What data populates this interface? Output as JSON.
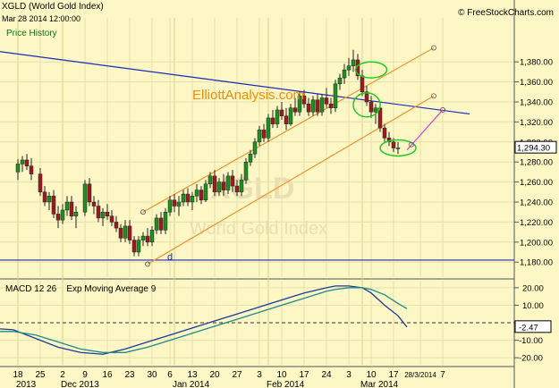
{
  "header": {
    "symbol_line": "XGLD (World Gold Index)",
    "datetime": "Mar 28 2014 12:00:00",
    "source": "© FreeStockCharts.com",
    "price_history_label": "Price History",
    "elliott_watermark": "ElliottAnalysis.com",
    "big_watermark_symbol": "XGLD",
    "big_watermark_name": "World Gold Index"
  },
  "colors": {
    "background": "#fdf7c6",
    "up_candle": "#1f8f1f",
    "down_candle": "#9b1c1c",
    "channel": "#f0932c",
    "trendline": "#1a2ab8",
    "projection": "#e03ccf",
    "ellipse": "#22c922",
    "macd_line": "#1a3a9c",
    "signal_line": "#1e8a8a"
  },
  "chart_data": [
    {
      "type": "candlestick",
      "title": "Price History",
      "series_name": "XGLD (World Gold Index)",
      "ylim": [
        1165,
        1415
      ],
      "y_ticks": [
        "1,180.00",
        "1,200.00",
        "1,220.00",
        "1,240.00",
        "1,260.00",
        "1,280.00",
        "1,300.00",
        "1,320.00",
        "1,340.00",
        "1,360.00",
        "1,380.00"
      ],
      "y_tick_values": [
        1180,
        1200,
        1220,
        1240,
        1260,
        1280,
        1300,
        1320,
        1340,
        1360,
        1380
      ],
      "last_value_label": "1,294.30",
      "last_value": 1294.3,
      "x_ticks": [
        "18",
        "25",
        "2",
        "9",
        "16",
        "23",
        "30",
        "6",
        "13",
        "20",
        "27",
        "3",
        "10",
        "17",
        "24",
        "3",
        "10",
        "17",
        "28/3/2014",
        "7"
      ],
      "x_tick_indices": [
        1,
        6,
        11,
        16,
        21,
        26,
        31,
        35,
        40,
        45,
        50,
        55,
        60,
        65,
        70,
        75,
        80,
        85,
        91,
        96
      ],
      "month_labels": [
        {
          "label": "2013",
          "index": -1
        },
        {
          "label": "Dec 2013",
          "index": 9
        },
        {
          "label": "Jan 2014",
          "index": 34
        },
        {
          "label": "Feb 2014",
          "index": 55
        },
        {
          "label": "Mar 2014",
          "index": 76
        }
      ],
      "x_slots": 101,
      "candles": [
        [
          1,
          1270,
          1283,
          1262,
          1278
        ],
        [
          2,
          1278,
          1286,
          1270,
          1282
        ],
        [
          3,
          1282,
          1288,
          1272,
          1276
        ],
        [
          4,
          1276,
          1284,
          1262,
          1268
        ],
        [
          6,
          1268,
          1274,
          1246,
          1250
        ],
        [
          7,
          1250,
          1256,
          1236,
          1240
        ],
        [
          8,
          1240,
          1250,
          1232,
          1246
        ],
        [
          9,
          1246,
          1252,
          1224,
          1228
        ],
        [
          10,
          1228,
          1236,
          1214,
          1222
        ],
        [
          11,
          1222,
          1238,
          1218,
          1232
        ],
        [
          12,
          1232,
          1246,
          1226,
          1240
        ],
        [
          13,
          1240,
          1246,
          1222,
          1226
        ],
        [
          14,
          1226,
          1236,
          1214,
          1230
        ],
        [
          16,
          1230,
          1262,
          1226,
          1258
        ],
        [
          17,
          1258,
          1264,
          1236,
          1240
        ],
        [
          18,
          1240,
          1246,
          1228,
          1236
        ],
        [
          19,
          1236,
          1242,
          1220,
          1224
        ],
        [
          20,
          1224,
          1234,
          1216,
          1230
        ],
        [
          21,
          1230,
          1238,
          1222,
          1226
        ],
        [
          22,
          1226,
          1232,
          1216,
          1220
        ],
        [
          23,
          1220,
          1226,
          1210,
          1214
        ],
        [
          24,
          1214,
          1218,
          1200,
          1204
        ],
        [
          25,
          1204,
          1222,
          1200,
          1216
        ],
        [
          26,
          1216,
          1222,
          1198,
          1202
        ],
        [
          27,
          1202,
          1206,
          1186,
          1190
        ],
        [
          28,
          1190,
          1206,
          1186,
          1202
        ],
        [
          29,
          1202,
          1210,
          1196,
          1206
        ],
        [
          30,
          1206,
          1214,
          1196,
          1200
        ],
        [
          31,
          1200,
          1216,
          1196,
          1212
        ],
        [
          32,
          1212,
          1228,
          1208,
          1224
        ],
        [
          33,
          1224,
          1230,
          1208,
          1212
        ],
        [
          34,
          1212,
          1234,
          1208,
          1230
        ],
        [
          35,
          1230,
          1246,
          1226,
          1242
        ],
        [
          36,
          1242,
          1248,
          1230,
          1236
        ],
        [
          37,
          1236,
          1246,
          1226,
          1240
        ],
        [
          38,
          1240,
          1252,
          1236,
          1248
        ],
        [
          39,
          1248,
          1254,
          1236,
          1240
        ],
        [
          40,
          1240,
          1250,
          1232,
          1246
        ],
        [
          41,
          1246,
          1258,
          1240,
          1252
        ],
        [
          42,
          1252,
          1256,
          1238,
          1242
        ],
        [
          43,
          1242,
          1262,
          1240,
          1258
        ],
        [
          44,
          1258,
          1270,
          1254,
          1266
        ],
        [
          45,
          1266,
          1272,
          1246,
          1250
        ],
        [
          46,
          1250,
          1264,
          1246,
          1260
        ],
        [
          47,
          1260,
          1268,
          1246,
          1252
        ],
        [
          48,
          1252,
          1270,
          1248,
          1266
        ],
        [
          49,
          1266,
          1272,
          1250,
          1256
        ],
        [
          50,
          1256,
          1262,
          1246,
          1250
        ],
        [
          51,
          1250,
          1268,
          1246,
          1262
        ],
        [
          52,
          1262,
          1284,
          1258,
          1280
        ],
        [
          53,
          1280,
          1292,
          1276,
          1288
        ],
        [
          54,
          1288,
          1304,
          1284,
          1300
        ],
        [
          55,
          1300,
          1316,
          1296,
          1312
        ],
        [
          56,
          1312,
          1318,
          1300,
          1304
        ],
        [
          57,
          1304,
          1328,
          1300,
          1324
        ],
        [
          58,
          1324,
          1332,
          1314,
          1318
        ],
        [
          59,
          1318,
          1336,
          1314,
          1332
        ],
        [
          60,
          1332,
          1340,
          1322,
          1326
        ],
        [
          61,
          1326,
          1334,
          1312,
          1318
        ],
        [
          62,
          1318,
          1338,
          1316,
          1334
        ],
        [
          63,
          1334,
          1344,
          1326,
          1330
        ],
        [
          64,
          1330,
          1350,
          1326,
          1346
        ],
        [
          65,
          1346,
          1352,
          1334,
          1338
        ],
        [
          66,
          1338,
          1344,
          1326,
          1330
        ],
        [
          67,
          1330,
          1346,
          1326,
          1342
        ],
        [
          68,
          1342,
          1348,
          1326,
          1330
        ],
        [
          69,
          1330,
          1348,
          1326,
          1344
        ],
        [
          70,
          1344,
          1354,
          1334,
          1338
        ],
        [
          71,
          1338,
          1344,
          1328,
          1334
        ],
        [
          72,
          1334,
          1362,
          1330,
          1358
        ],
        [
          73,
          1358,
          1368,
          1352,
          1364
        ],
        [
          74,
          1364,
          1378,
          1358,
          1372
        ],
        [
          75,
          1372,
          1384,
          1366,
          1376
        ],
        [
          76,
          1376,
          1392,
          1370,
          1382
        ],
        [
          77,
          1382,
          1388,
          1362,
          1366
        ],
        [
          78,
          1366,
          1372,
          1346,
          1350
        ],
        [
          79,
          1350,
          1356,
          1336,
          1340
        ],
        [
          80,
          1340,
          1346,
          1324,
          1330
        ],
        [
          81,
          1330,
          1338,
          1318,
          1334
        ],
        [
          82,
          1334,
          1338,
          1310,
          1314
        ],
        [
          83,
          1314,
          1318,
          1300,
          1304
        ],
        [
          84,
          1304,
          1310,
          1296,
          1300
        ],
        [
          85,
          1300,
          1304,
          1290,
          1294
        ],
        [
          86,
          1294,
          1300,
          1288,
          1294
        ]
      ],
      "annotations": {
        "channel_upper": {
          "from": [
            29,
            1230
          ],
          "to": [
            94,
            1394
          ]
        },
        "channel_lower": {
          "from": [
            30,
            1178
          ],
          "to": [
            94,
            1346
          ]
        },
        "descending_trendline": {
          "from": [
            -6,
            1392
          ],
          "to": [
            102,
            1328
          ]
        },
        "horizontal_support": 1182,
        "projection": {
          "from": [
            88,
            1292
          ],
          "to": [
            96,
            1332
          ]
        },
        "label_d": "d",
        "label_d_point": [
          35,
          1181
        ],
        "ellipses": [
          {
            "x": 80,
            "y": 1372,
            "rx": 3.5,
            "ry": 8
          },
          {
            "x": 79,
            "y": 1337,
            "rx": 3.0,
            "ry": 12
          },
          {
            "x": 86,
            "y": 1294,
            "rx": 4.0,
            "ry": 8
          }
        ]
      }
    },
    {
      "type": "line",
      "title": "MACD 12 26",
      "subtitle": "Exp Moving Average 9",
      "ylim": [
        -24,
        24
      ],
      "y_ticks": [
        "20.00",
        "10.00",
        "-10.00",
        "-20.00"
      ],
      "y_tick_values": [
        20,
        10,
        -10,
        -20
      ],
      "last_value_label": "-2.47",
      "last_value": -2.47,
      "series": [
        {
          "name": "MACD 12 26",
          "x": [
            -6,
            0,
            5,
            10,
            15,
            20,
            25,
            30,
            35,
            40,
            45,
            50,
            55,
            60,
            65,
            70,
            72,
            75,
            78,
            80,
            83,
            86,
            88
          ],
          "values": [
            -3,
            -4,
            -9,
            -14,
            -17,
            -18,
            -15,
            -11,
            -7,
            -3,
            1,
            5,
            9,
            13,
            17,
            20,
            21,
            21,
            20,
            17,
            10,
            4,
            -2.47
          ]
        },
        {
          "name": "Exp Moving Average 9",
          "x": [
            -6,
            0,
            5,
            10,
            15,
            20,
            25,
            30,
            35,
            40,
            45,
            50,
            55,
            60,
            65,
            70,
            72,
            75,
            78,
            80,
            83,
            86,
            88
          ],
          "values": [
            -5,
            -5,
            -7,
            -11,
            -15,
            -17,
            -17,
            -14,
            -10,
            -6,
            -2,
            2,
            6,
            10,
            14,
            18,
            19,
            20,
            20,
            19,
            16,
            11,
            8
          ]
        }
      ],
      "zero_line": true,
      "grid": true
    }
  ]
}
